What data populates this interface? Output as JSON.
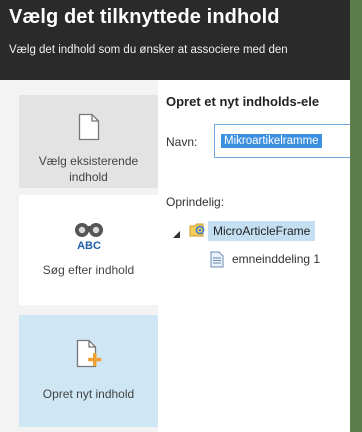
{
  "header": {
    "title": "Vælg det tilknyttede indhold",
    "subtitle": "Vælg det indhold som du ønsker at associere med den"
  },
  "sidebar": {
    "items": [
      {
        "label": "Vælg eksisterende indhold",
        "icon": "document-icon",
        "selected": false
      },
      {
        "label": "Søg efter indhold",
        "icon": "binoculars-abc-icon",
        "selected": false
      },
      {
        "label": "Opret nyt indhold",
        "icon": "new-document-icon",
        "selected": true
      }
    ]
  },
  "form": {
    "section_title": "Opret et nyt indholds-ele",
    "name_label": "Navn:",
    "name_value": "Mikroartikelramme",
    "origin_label": "Oprindelig:"
  },
  "tree": {
    "root_label": "MicroArticleFrame",
    "child_label": "emneinddeling 1"
  },
  "colors": {
    "header_bg": "#2a2a2a",
    "selected_item_bg": "#cfe6f4",
    "tree_highlight": "#c5dff2",
    "input_selection": "#3d8fe0",
    "accent_orange": "#f0a030"
  }
}
